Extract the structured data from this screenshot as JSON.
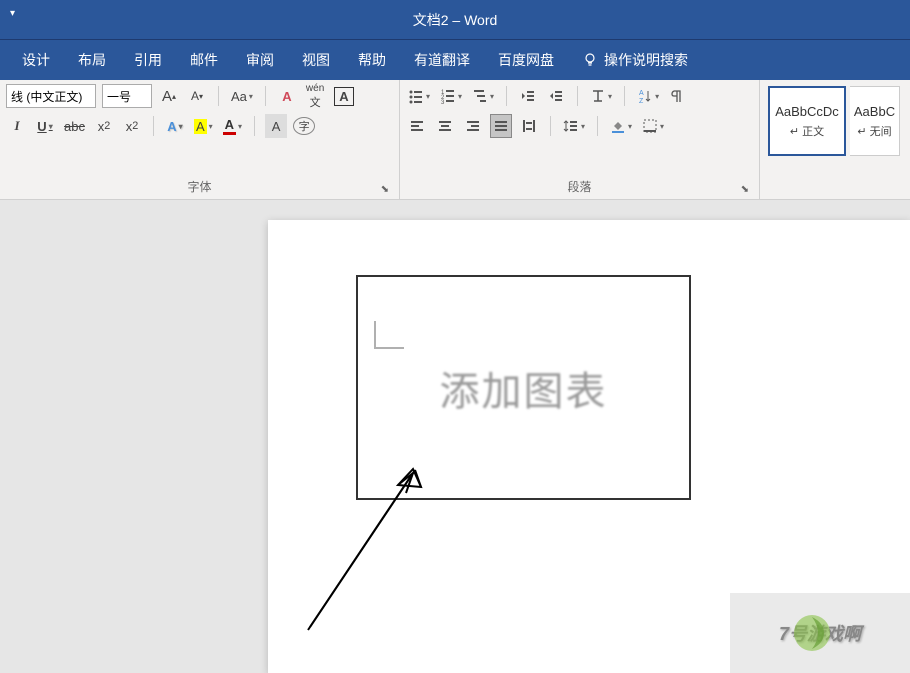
{
  "title": "文档2  –  Word",
  "menu": {
    "design": "设计",
    "layout": "布局",
    "references": "引用",
    "mail": "邮件",
    "review": "审阅",
    "view": "视图",
    "help": "帮助",
    "youdao": "有道翻译",
    "baidu": "百度网盘",
    "tellme": "操作说明搜索"
  },
  "ribbon": {
    "font": {
      "name": "线 (中文正文)",
      "size": "一号",
      "bold": "I",
      "underline": "U",
      "strike": "abc",
      "grow": "A",
      "shrink": "A",
      "case": "Aa",
      "clear": "A",
      "phonetic": "wén",
      "border": "A",
      "sub": "x₂",
      "sup": "x²",
      "effects": "A",
      "highlight": "A",
      "fontcolor": "A",
      "circled": "A",
      "group_label": "字体"
    },
    "paragraph": {
      "group_label": "段落"
    },
    "styles": {
      "normal_preview": "AaBbCcDc",
      "normal_name": "↵ 正文",
      "nospace_preview": "AaBbC",
      "nospace_name": "↵ 无间"
    }
  },
  "document": {
    "textbox_text": "添加图表"
  },
  "watermark": {
    "brand1": "7号游戏啊",
    "brand2": "游戏"
  }
}
